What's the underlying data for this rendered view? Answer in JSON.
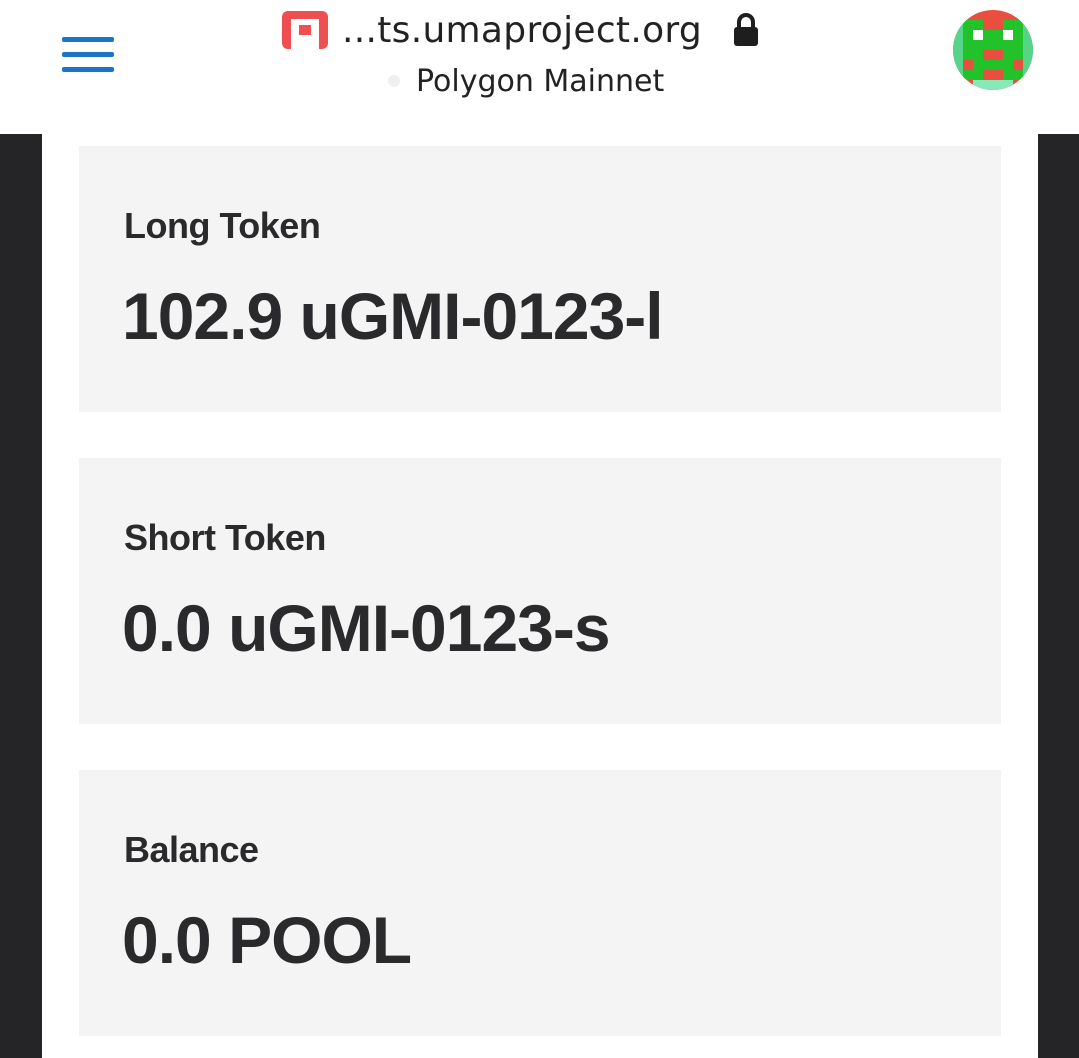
{
  "browser": {
    "url": "...ts.umaproject.org",
    "network": "Polygon Mainnet",
    "icons": {
      "menu": "hamburger-menu-icon",
      "site": "site-favicon-icon",
      "lock": "lock-icon",
      "avatar": "account-avatar"
    },
    "colors": {
      "menu": "#1a74c8",
      "favicon": "#ef4f50",
      "side_panels": "#252527",
      "card_background": "#f4f4f4",
      "text": "#2a2a2c"
    }
  },
  "cards": [
    {
      "label": "Long Token",
      "value": "102.9 uGMI-0123-l"
    },
    {
      "label": "Short Token",
      "value": "0.0 uGMI-0123-s"
    },
    {
      "label": "Balance",
      "value": "0.0 POOL"
    }
  ]
}
